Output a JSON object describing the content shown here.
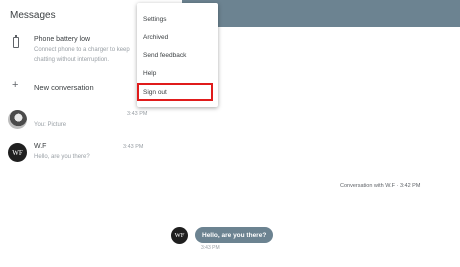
{
  "app": {
    "title": "Messages"
  },
  "notice": {
    "icon": "battery-icon",
    "title": "Phone battery low",
    "subtitle": "Connect phone to a charger to keep chatting without interruption."
  },
  "new_conversation": {
    "icon": "plus-icon",
    "label": "New conversation"
  },
  "conversations": [
    {
      "avatar": "photo",
      "time": "3:43 PM",
      "preview": "You: Picture"
    },
    {
      "avatar_initials": "WF",
      "name": "W.F",
      "time": "3:43 PM",
      "preview": "Hello, are you there?"
    }
  ],
  "menu": {
    "items": [
      "Settings",
      "Archived",
      "Send feedback",
      "Help",
      "Sign out"
    ],
    "highlighted": "Sign out",
    "highlight_color": "#e01b1b"
  },
  "conversation_view": {
    "header": "Conversation with W.F",
    "header_time": "3:42 PM",
    "message": {
      "avatar_initials": "WF",
      "text": "Hello, are you there?",
      "time": "3:43 PM"
    }
  },
  "colors": {
    "accent": "#6c8391"
  }
}
